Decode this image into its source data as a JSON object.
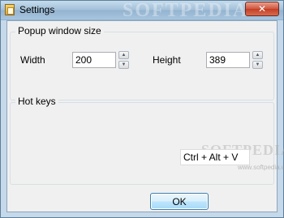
{
  "window": {
    "title": "Settings",
    "close_label": "✕",
    "watermark": "SOFTPEDIA"
  },
  "popup_size": {
    "group_label": "Popup window size",
    "width_label": "Width",
    "width_value": "200",
    "height_label": "Height",
    "height_value": "389"
  },
  "hot_keys": {
    "group_label": "Hot keys",
    "shortcut_value": "Ctrl + Alt + V",
    "watermark": "SOFTPEDIA",
    "watermark_sub": "www.softpedia.com"
  },
  "footer": {
    "ok_label": "OK"
  },
  "icons": {
    "spin_up": "▲",
    "spin_down": "▼"
  }
}
